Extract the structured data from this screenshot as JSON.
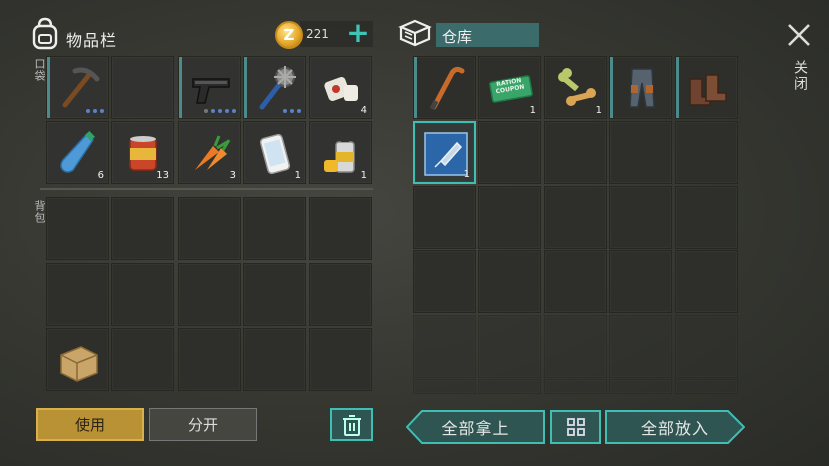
{
  "inventory": {
    "title": "物品栏",
    "coins": "221",
    "pocket_label": "口袋",
    "backpack_label": "背包",
    "pocket_slots": [
      {
        "icon": "pickaxe-icon",
        "count": "",
        "dots": 3,
        "bar": true
      },
      {
        "icon": "",
        "count": "",
        "dots": 0,
        "bar": false
      },
      {
        "icon": "pistol-icon",
        "count": "",
        "dots": 5,
        "bar": true
      },
      {
        "icon": "spiked-mace-icon",
        "count": "",
        "dots": 3,
        "bar": true
      },
      {
        "icon": "bandage-icon",
        "count": "4",
        "dots": 0,
        "bar": false
      },
      {
        "icon": "water-bottle-icon",
        "count": "6",
        "dots": 0,
        "bar": false
      },
      {
        "icon": "canned-food-icon",
        "count": "13",
        "dots": 0,
        "bar": false
      },
      {
        "icon": "carrot-icon",
        "count": "3",
        "dots": 0,
        "bar": false
      },
      {
        "icon": "smartphone-icon",
        "count": "1",
        "dots": 0,
        "bar": false
      },
      {
        "icon": "spray-paint-icon",
        "count": "1",
        "dots": 0,
        "bar": false
      }
    ],
    "backpack_slots": [
      {
        "icon": "",
        "count": ""
      },
      {
        "icon": "",
        "count": ""
      },
      {
        "icon": "",
        "count": ""
      },
      {
        "icon": "",
        "count": ""
      },
      {
        "icon": "",
        "count": ""
      },
      {
        "icon": "",
        "count": ""
      },
      {
        "icon": "",
        "count": ""
      },
      {
        "icon": "",
        "count": ""
      },
      {
        "icon": "",
        "count": ""
      },
      {
        "icon": "",
        "count": ""
      },
      {
        "icon": "cardboard-box-icon",
        "count": ""
      },
      {
        "icon": "",
        "count": ""
      },
      {
        "icon": "",
        "count": ""
      },
      {
        "icon": "",
        "count": ""
      },
      {
        "icon": "",
        "count": ""
      }
    ],
    "use_label": "使用",
    "split_label": "分开"
  },
  "storage": {
    "title": "仓库",
    "slots": [
      {
        "icon": "crowbar-icon",
        "count": "",
        "bar": true
      },
      {
        "icon": "ration-coupon-icon",
        "count": "1",
        "bar": false
      },
      {
        "icon": "dog-bone-icon",
        "count": "1",
        "bar": false
      },
      {
        "icon": "armored-pants-icon",
        "count": "",
        "bar": true
      },
      {
        "icon": "boots-icon",
        "count": "",
        "bar": true
      },
      {
        "icon": "cleaver-blueprint-icon",
        "count": "1",
        "bar": false,
        "selected": true
      }
    ],
    "coupon_text": [
      "RATION",
      "COUPON"
    ],
    "take_all_label": "全部拿上",
    "put_all_label": "全部放入"
  },
  "close_label": "关闭",
  "colors": {
    "accent": "#3fbfb4",
    "use_button": "#b99235",
    "dot_blue": "#5a82c8"
  }
}
